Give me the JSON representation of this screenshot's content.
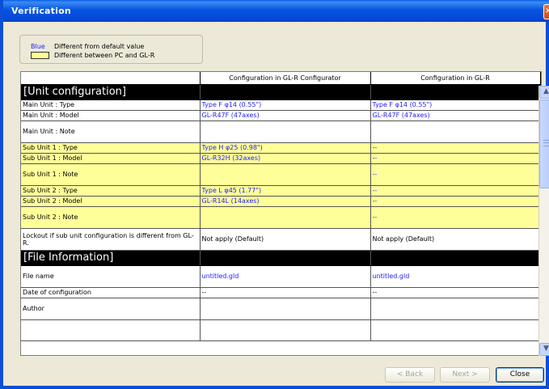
{
  "window": {
    "title": "Verification"
  },
  "legend": {
    "blue_label": "Blue",
    "blue_text": "Different from default value",
    "yellow_text": "Different between PC and GL-R",
    "blue_color": "#1c1cff",
    "yellow_color": "#ffff99"
  },
  "table": {
    "headers": [
      "",
      "Configuration in GL-R Configurator",
      "Configuration in GL-R"
    ],
    "sections": {
      "unit": "[Unit configuration]",
      "file": "[File Information]"
    },
    "rows": [
      {
        "label": "Main Unit : Type",
        "pc": "Type F φ14 (0.55\")",
        "glr": "Type F φ14 (0.55\")"
      },
      {
        "label": "Main Unit : Model",
        "pc": "GL-R47F (47axes)",
        "glr": "GL-R47F (47axes)"
      },
      {
        "label": "Main Unit : Note",
        "pc": "",
        "glr": ""
      },
      {
        "label": "Sub Unit 1 : Type",
        "pc": "Type H φ25 (0.98\")",
        "glr": "--"
      },
      {
        "label": "Sub Unit 1 : Model",
        "pc": "GL-R32H (32axes)",
        "glr": "--"
      },
      {
        "label": "Sub Unit 1 : Note",
        "pc": "",
        "glr": "--"
      },
      {
        "label": "Sub Unit 2 : Type",
        "pc": "Type L φ45 (1.77\")",
        "glr": "--"
      },
      {
        "label": "Sub Unit 2 : Model",
        "pc": "GL-R14L (14axes)",
        "glr": "--"
      },
      {
        "label": "Sub Unit 2 : Note",
        "pc": "",
        "glr": "--"
      },
      {
        "label": "Lockout if sub unit configuration is different from GL-R.",
        "pc": "Not apply (Default)",
        "glr": "Not apply (Default)"
      },
      {
        "label": "File name",
        "pc": "untitled.gld",
        "glr": "untitled.gld"
      },
      {
        "label": "Date of configuration",
        "pc": "--",
        "glr": "--"
      },
      {
        "label": "Author",
        "pc": "",
        "glr": ""
      },
      {
        "label": "",
        "pc": "",
        "glr": ""
      }
    ]
  },
  "buttons": {
    "back": "< Back",
    "next": "Next >",
    "close": "Close"
  }
}
